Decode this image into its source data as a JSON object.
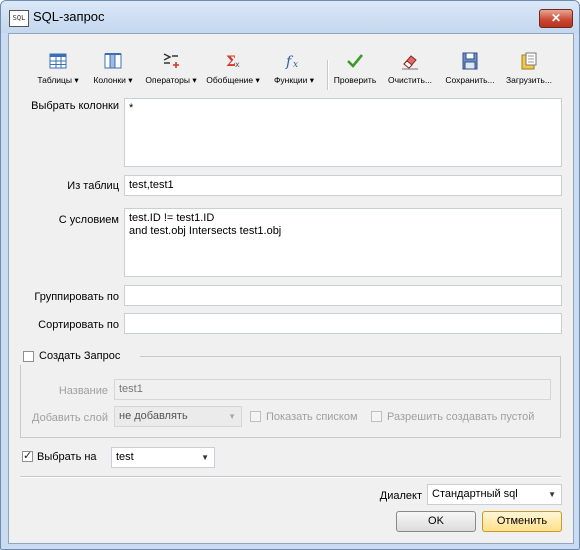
{
  "window": {
    "title": "SQL-запрос",
    "app_icon_text": "SQL",
    "close_symbol": "✕"
  },
  "toolbar": [
    {
      "label": "Таблицы ▾",
      "icon": "table-icon"
    },
    {
      "label": "Колонки ▾",
      "icon": "columns-icon"
    },
    {
      "label": "Операторы ▾",
      "icon": "operators-icon"
    },
    {
      "label": "Обобщение ▾",
      "icon": "sum-icon"
    },
    {
      "label": "Функции ▾",
      "icon": "function-icon"
    },
    {
      "label": "Проверить",
      "icon": "checkmark-icon"
    },
    {
      "label": "Очистить...",
      "icon": "eraser-icon"
    },
    {
      "label": "Сохранить...",
      "icon": "save-icon"
    },
    {
      "label": "Загрузить...",
      "icon": "load-icon"
    }
  ],
  "query": {
    "select_label": "Выбрать колонки",
    "select_value": "*",
    "from_label": "Из таблиц",
    "from_value": "test,test1",
    "where_label": "С условием",
    "where_value": "test.ID != test1.ID\nand test.obj Intersects test1.obj",
    "group_label": "Группировать по",
    "group_value": "",
    "order_label": "Сортировать по",
    "order_value": ""
  },
  "create_query": {
    "label": "Создать Запрос",
    "checked": false,
    "name_label": "Название",
    "name_value": "test1",
    "add_layer_label": "Добавить слой",
    "add_layer_value": "не добавлять",
    "show_list_label": "Показать списком",
    "allow_empty_label": "Разрешить создавать пустой"
  },
  "select_on": {
    "label": "Выбрать на",
    "checked": true,
    "value": "test"
  },
  "dialect": {
    "label": "Диалект",
    "value": "Стандартный sql"
  },
  "buttons": {
    "ok": "OK",
    "cancel": "Отменить"
  },
  "colors": {
    "title_bar": "#c9dcf1",
    "close_button": "#c8462f",
    "cancel_highlight": "#ffe08a"
  }
}
